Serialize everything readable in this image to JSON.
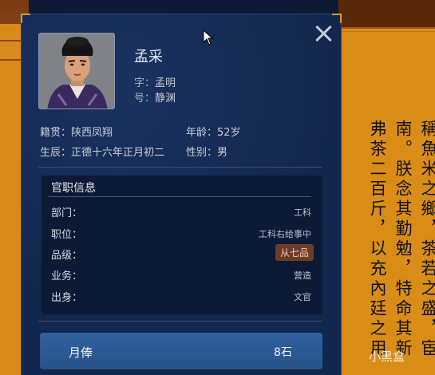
{
  "scroll_text": {
    "columns": [
      "稱魚米之鄉，茶若之盛，宦",
      "南。朕念其勤勉，特命其新",
      "弗茶二百斤，以充內廷之用"
    ]
  },
  "character": {
    "name": "孟采",
    "zi_label": "字：",
    "zi_value": "孟明",
    "hao_label": "号：",
    "hao_value": "静渊",
    "native_label": "籍贯：",
    "native_value": "陕西凤翔",
    "age_label": "年龄：",
    "age_value": "52岁",
    "birth_label": "生辰：",
    "birth_value": "正德十六年正月初二",
    "gender_label": "性别：",
    "gender_value": "男"
  },
  "office": {
    "title": "官职信息",
    "rows": [
      {
        "label": "部门：",
        "value": "工科"
      },
      {
        "label": "职位：",
        "value": "工科右给事中"
      },
      {
        "label": "品级：",
        "value": "从七品"
      },
      {
        "label": "业务：",
        "value": "营造"
      },
      {
        "label": "出身：",
        "value": "文官"
      }
    ]
  },
  "salary": {
    "label": "月俸",
    "value": "8石"
  },
  "watermark": "小黑盒",
  "colors": {
    "panel_bg": "#13264d",
    "section_bg": "#0c1a36",
    "salary_bg": "#2b5893",
    "rank_badge_bg": "#6d3c27",
    "scene_orange": "#d98d17"
  }
}
